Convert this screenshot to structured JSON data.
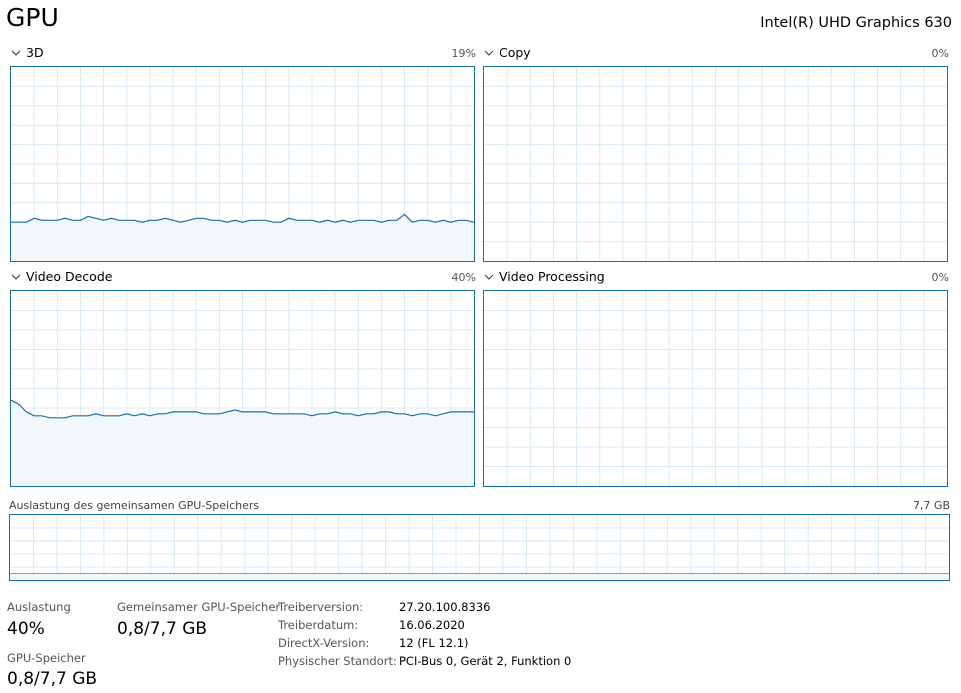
{
  "header": {
    "title": "GPU",
    "device_name": "Intel(R) UHD Graphics 630"
  },
  "graphs": {
    "g3d": {
      "label": "3D",
      "value": "19%"
    },
    "copy": {
      "label": "Copy",
      "value": "0%"
    },
    "video_decode": {
      "label": "Video Decode",
      "value": "40%"
    },
    "video_processing": {
      "label": "Video Processing",
      "value": "0%"
    },
    "shared_memory": {
      "label": "Auslastung des gemeinsamen GPU-Speichers",
      "value": "7,7 GB"
    }
  },
  "stats": {
    "utilization_label": "Auslastung",
    "utilization_value": "40%",
    "shared_memory_label": "Gemeinsamer GPU-Speicher",
    "shared_memory_value": "0,8/7,7 GB",
    "gpu_memory_label": "GPU-Speicher",
    "gpu_memory_value": "0,8/7,7 GB"
  },
  "info": [
    {
      "label": "Treiberversion:",
      "value": "27.20.100.8336"
    },
    {
      "label": "Treiberdatum:",
      "value": "16.06.2020"
    },
    {
      "label": "DirectX-Version:",
      "value": "12 (FL 12.1)"
    },
    {
      "label": "Physischer Standort:",
      "value": "PCI-Bus 0, Gerät 2, Funktion 0"
    }
  ],
  "colors": {
    "accent": "#1a6fa6",
    "grid": "#d9eaf4",
    "fill": "#f1f7fb"
  },
  "series": {
    "g3d": [
      20,
      20,
      20,
      22,
      21,
      21,
      21,
      22,
      21,
      21,
      23,
      22,
      21,
      22,
      21,
      21,
      21,
      20,
      21,
      21,
      22,
      21,
      20,
      21,
      22,
      22,
      21,
      21,
      20,
      21,
      20,
      21,
      21,
      21,
      20,
      20,
      22,
      21,
      21,
      21,
      20,
      21,
      20,
      21,
      20,
      21,
      21,
      21,
      20,
      21,
      21,
      24,
      20,
      21,
      21,
      20,
      21,
      20,
      21,
      21,
      20
    ],
    "video_decode": [
      44,
      42,
      38,
      36,
      36,
      35,
      35,
      35,
      36,
      36,
      36,
      37,
      36,
      36,
      36,
      37,
      36,
      37,
      36,
      37,
      37,
      38,
      38,
      38,
      38,
      37,
      37,
      37,
      38,
      39,
      38,
      38,
      38,
      38,
      37,
      37,
      37,
      37,
      37,
      36,
      37,
      37,
      38,
      37,
      37,
      36,
      37,
      37,
      38,
      38,
      37,
      37,
      36,
      37,
      37,
      36,
      37,
      38,
      38,
      38,
      38
    ]
  }
}
